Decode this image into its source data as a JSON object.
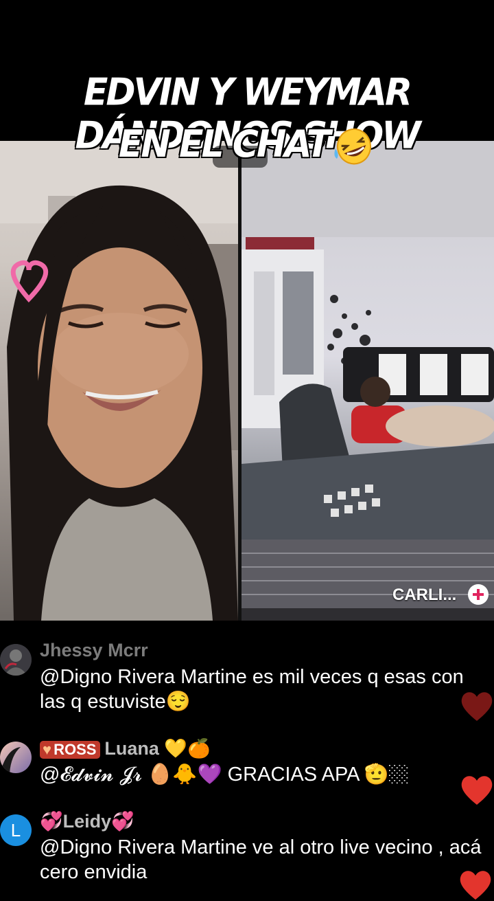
{
  "overlay": {
    "line1": "EDVIN Y WEYMAR DÁNDONOS SHOW",
    "line2": "EN EL CHAT"
  },
  "guest": {
    "name": "CARLI..."
  },
  "chat": {
    "messages": [
      {
        "user": "Jhessy Mcrr",
        "text": "@Digno Rivera Martine  es mil veces q esas con las q estuviste😌"
      },
      {
        "badge": "ROSS",
        "user": "Luana 💛🍊",
        "text": "@𝓔𝓭𝓿𝓲𝓷 𝓙𝓻 🥚🐥💜 GRACIAS APA 🫡🏼"
      },
      {
        "avatar_letter": "L",
        "user": "💞Leidy💞",
        "text": "@Digno Rivera Martine ve al otro live vecino , acá cero envidia"
      }
    ]
  },
  "colors": {
    "heart": "#e3352d",
    "avatar_l": "#1a8fe0",
    "username": "#bdbdbd",
    "badge": "#c0392b"
  }
}
